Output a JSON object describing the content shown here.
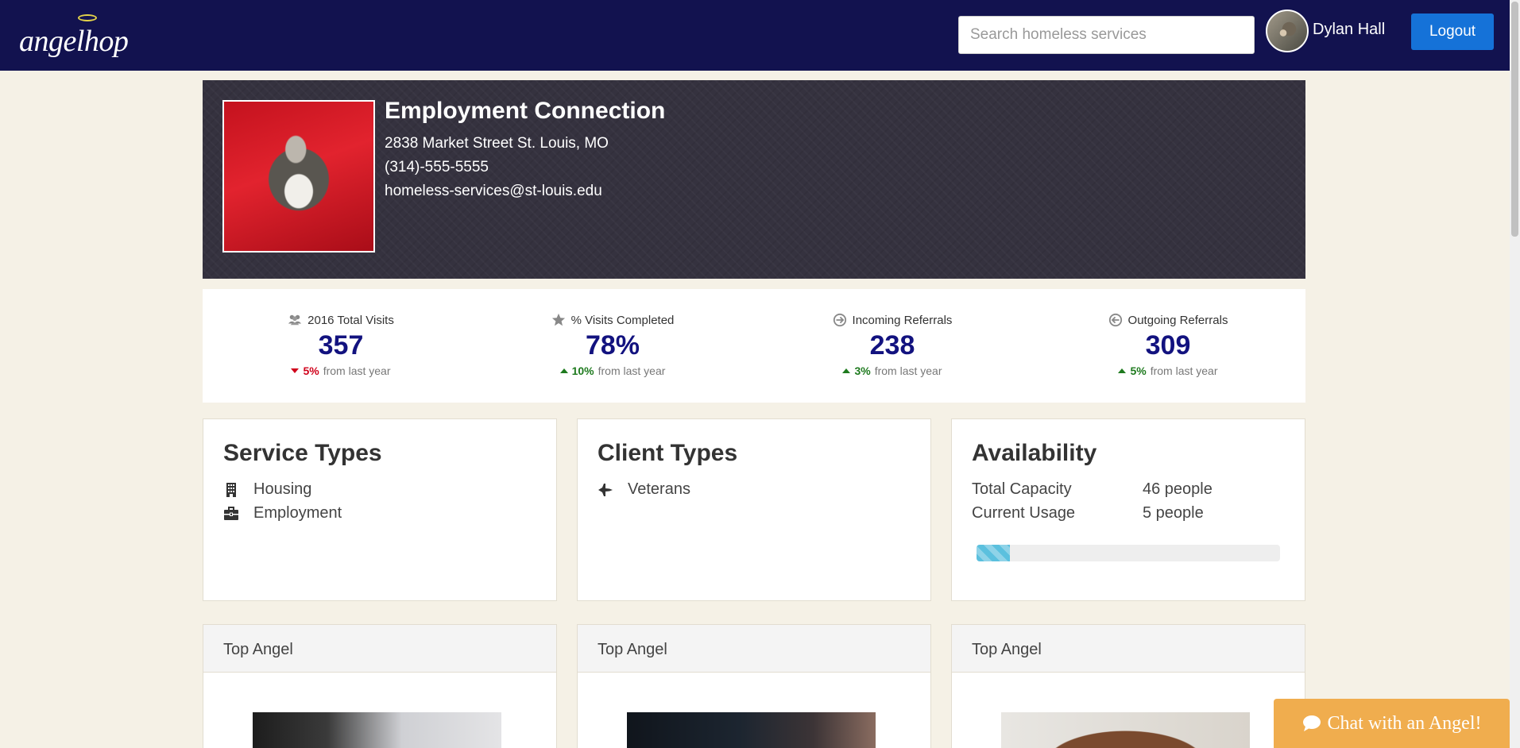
{
  "navbar": {
    "brand": "angelhop",
    "search_placeholder": "Search homeless services",
    "user_name": "Dylan Hall",
    "logout_label": "Logout"
  },
  "profile": {
    "name": "Employment Connection",
    "address": "2838 Market Street St. Louis, MO",
    "phone": "(314)-555-5555",
    "email": "homeless-services@st-louis.edu"
  },
  "stats": [
    {
      "icon": "users-icon",
      "label": "2016 Total Visits",
      "value": "357",
      "change": "5%",
      "direction": "down",
      "suffix": "from last year"
    },
    {
      "icon": "star-icon",
      "label": "% Visits Completed",
      "value": "78%",
      "change": "10%",
      "direction": "up",
      "suffix": "from last year"
    },
    {
      "icon": "arrow-circle-right-icon",
      "label": "Incoming Referrals",
      "value": "238",
      "change": "3%",
      "direction": "up",
      "suffix": "from last year"
    },
    {
      "icon": "arrow-circle-left-icon",
      "label": "Outgoing Referrals",
      "value": "309",
      "change": "5%",
      "direction": "up",
      "suffix": "from last year"
    }
  ],
  "service_types": {
    "title": "Service Types",
    "items": [
      {
        "icon": "building-icon",
        "label": "Housing"
      },
      {
        "icon": "briefcase-icon",
        "label": "Employment"
      }
    ]
  },
  "client_types": {
    "title": "Client Types",
    "items": [
      {
        "icon": "fighter-jet-icon",
        "label": "Veterans"
      }
    ]
  },
  "availability": {
    "title": "Availability",
    "total_capacity_label": "Total Capacity",
    "total_capacity_value": "46 people",
    "current_usage_label": "Current Usage",
    "current_usage_value": "5 people",
    "usage_fraction": 0.11
  },
  "top_angels": [
    {
      "title": "Top Angel"
    },
    {
      "title": "Top Angel"
    },
    {
      "title": "Top Angel"
    }
  ],
  "chat_button": {
    "icon": "comment-icon",
    "label": "Chat with an Angel!"
  },
  "colors": {
    "navbar": "#12124f",
    "accent_blue": "#1572d8",
    "stat_value": "#12127f",
    "up": "#1e7a1e",
    "down": "#d0021b",
    "chat": "#f0ad4e",
    "progress": "#5bc0de"
  }
}
